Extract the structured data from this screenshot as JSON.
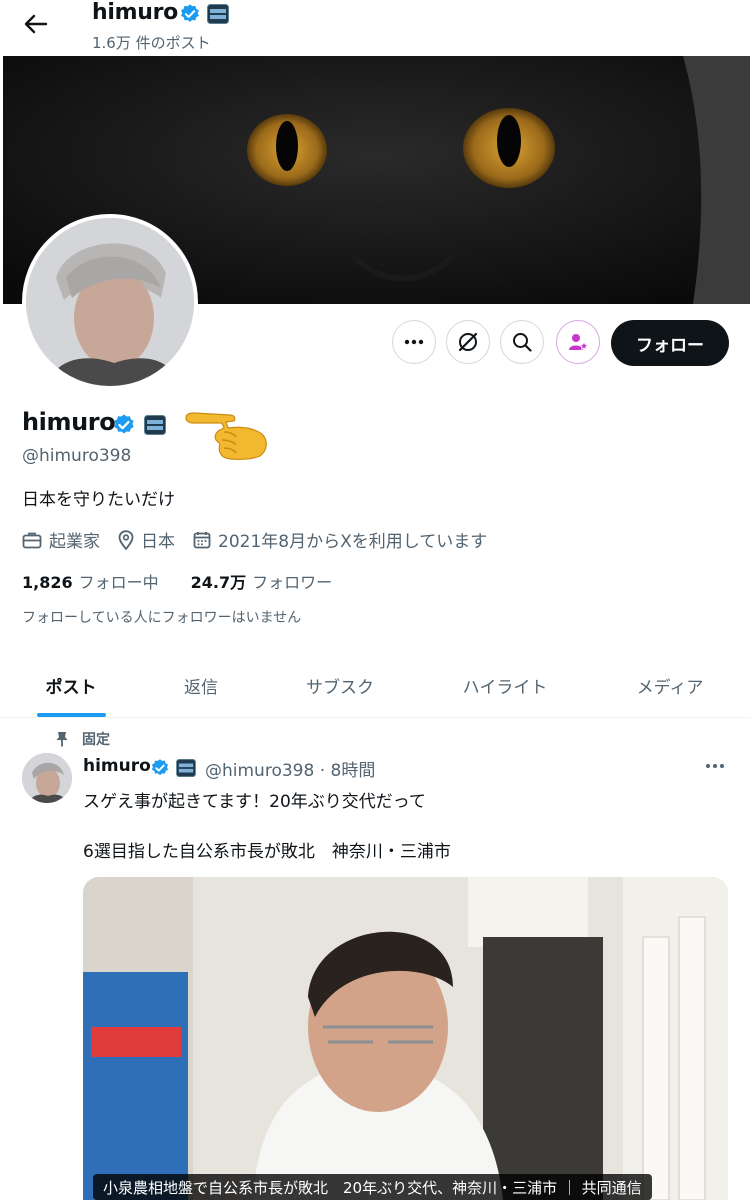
{
  "header": {
    "name": "himuro",
    "post_count": "1.6万 件のポスト",
    "back_icon": "arrow-left-icon"
  },
  "profile": {
    "name": "himuro",
    "handle": "@himuro398",
    "bio": "日本を守りたいだけ",
    "profession": "起業家",
    "location": "日本",
    "joined": "2021年8月からXを利用しています",
    "following_count": "1,826",
    "following_label": "フォロー中",
    "followers_count": "24.7万",
    "followers_label": "フォロワー",
    "followers_you_follow": "フォローしている人にフォロワーはいません",
    "badge_color": "#1d9bf0"
  },
  "actions": {
    "follow_label": "フォロー",
    "more_icon": "more-horizontal-icon",
    "grok_icon": "grok-icon",
    "search_icon": "search-icon",
    "subscribe_icon": "subscribe-icon",
    "subscribe_color": "#c936cc"
  },
  "tabs": [
    {
      "label": "ポスト",
      "active": true
    },
    {
      "label": "返信",
      "active": false
    },
    {
      "label": "サブスク",
      "active": false
    },
    {
      "label": "ハイライト",
      "active": false
    },
    {
      "label": "メディア",
      "active": false
    }
  ],
  "post": {
    "pinned_label": "固定",
    "author_name": "himuro",
    "author_handle_time": "@himuro398 · 8時間",
    "text_line1": "スゲえ事が起きてます！20年ぶり交代だって",
    "text_line2": "6選目指した自公系市長が敗北　神奈川・三浦市",
    "media_caption": "小泉農相地盤で自公系市長が敗北　20年ぶり交代、神奈川・三浦市 ｜ 共同通信"
  }
}
